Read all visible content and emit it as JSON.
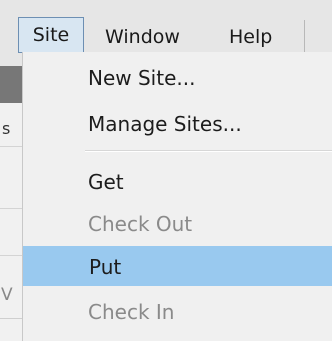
{
  "menubar": {
    "site": "Site",
    "window": "Window",
    "help": "Help"
  },
  "background": {
    "left_fragment_1": "s",
    "left_fragment_2": "V"
  },
  "site_menu": {
    "items": [
      {
        "label": "New Site...",
        "enabled": true
      },
      {
        "label": "Manage Sites...",
        "enabled": true
      },
      {
        "label": "Get",
        "enabled": true
      },
      {
        "label": "Check Out",
        "enabled": false
      },
      {
        "label": "Put",
        "enabled": true,
        "highlighted": true
      },
      {
        "label": "Check In",
        "enabled": false
      }
    ]
  },
  "colors": {
    "highlight": "#99c9ef",
    "menubar_active": "#d8e6f2",
    "disabled_text": "#8a8a8a"
  }
}
